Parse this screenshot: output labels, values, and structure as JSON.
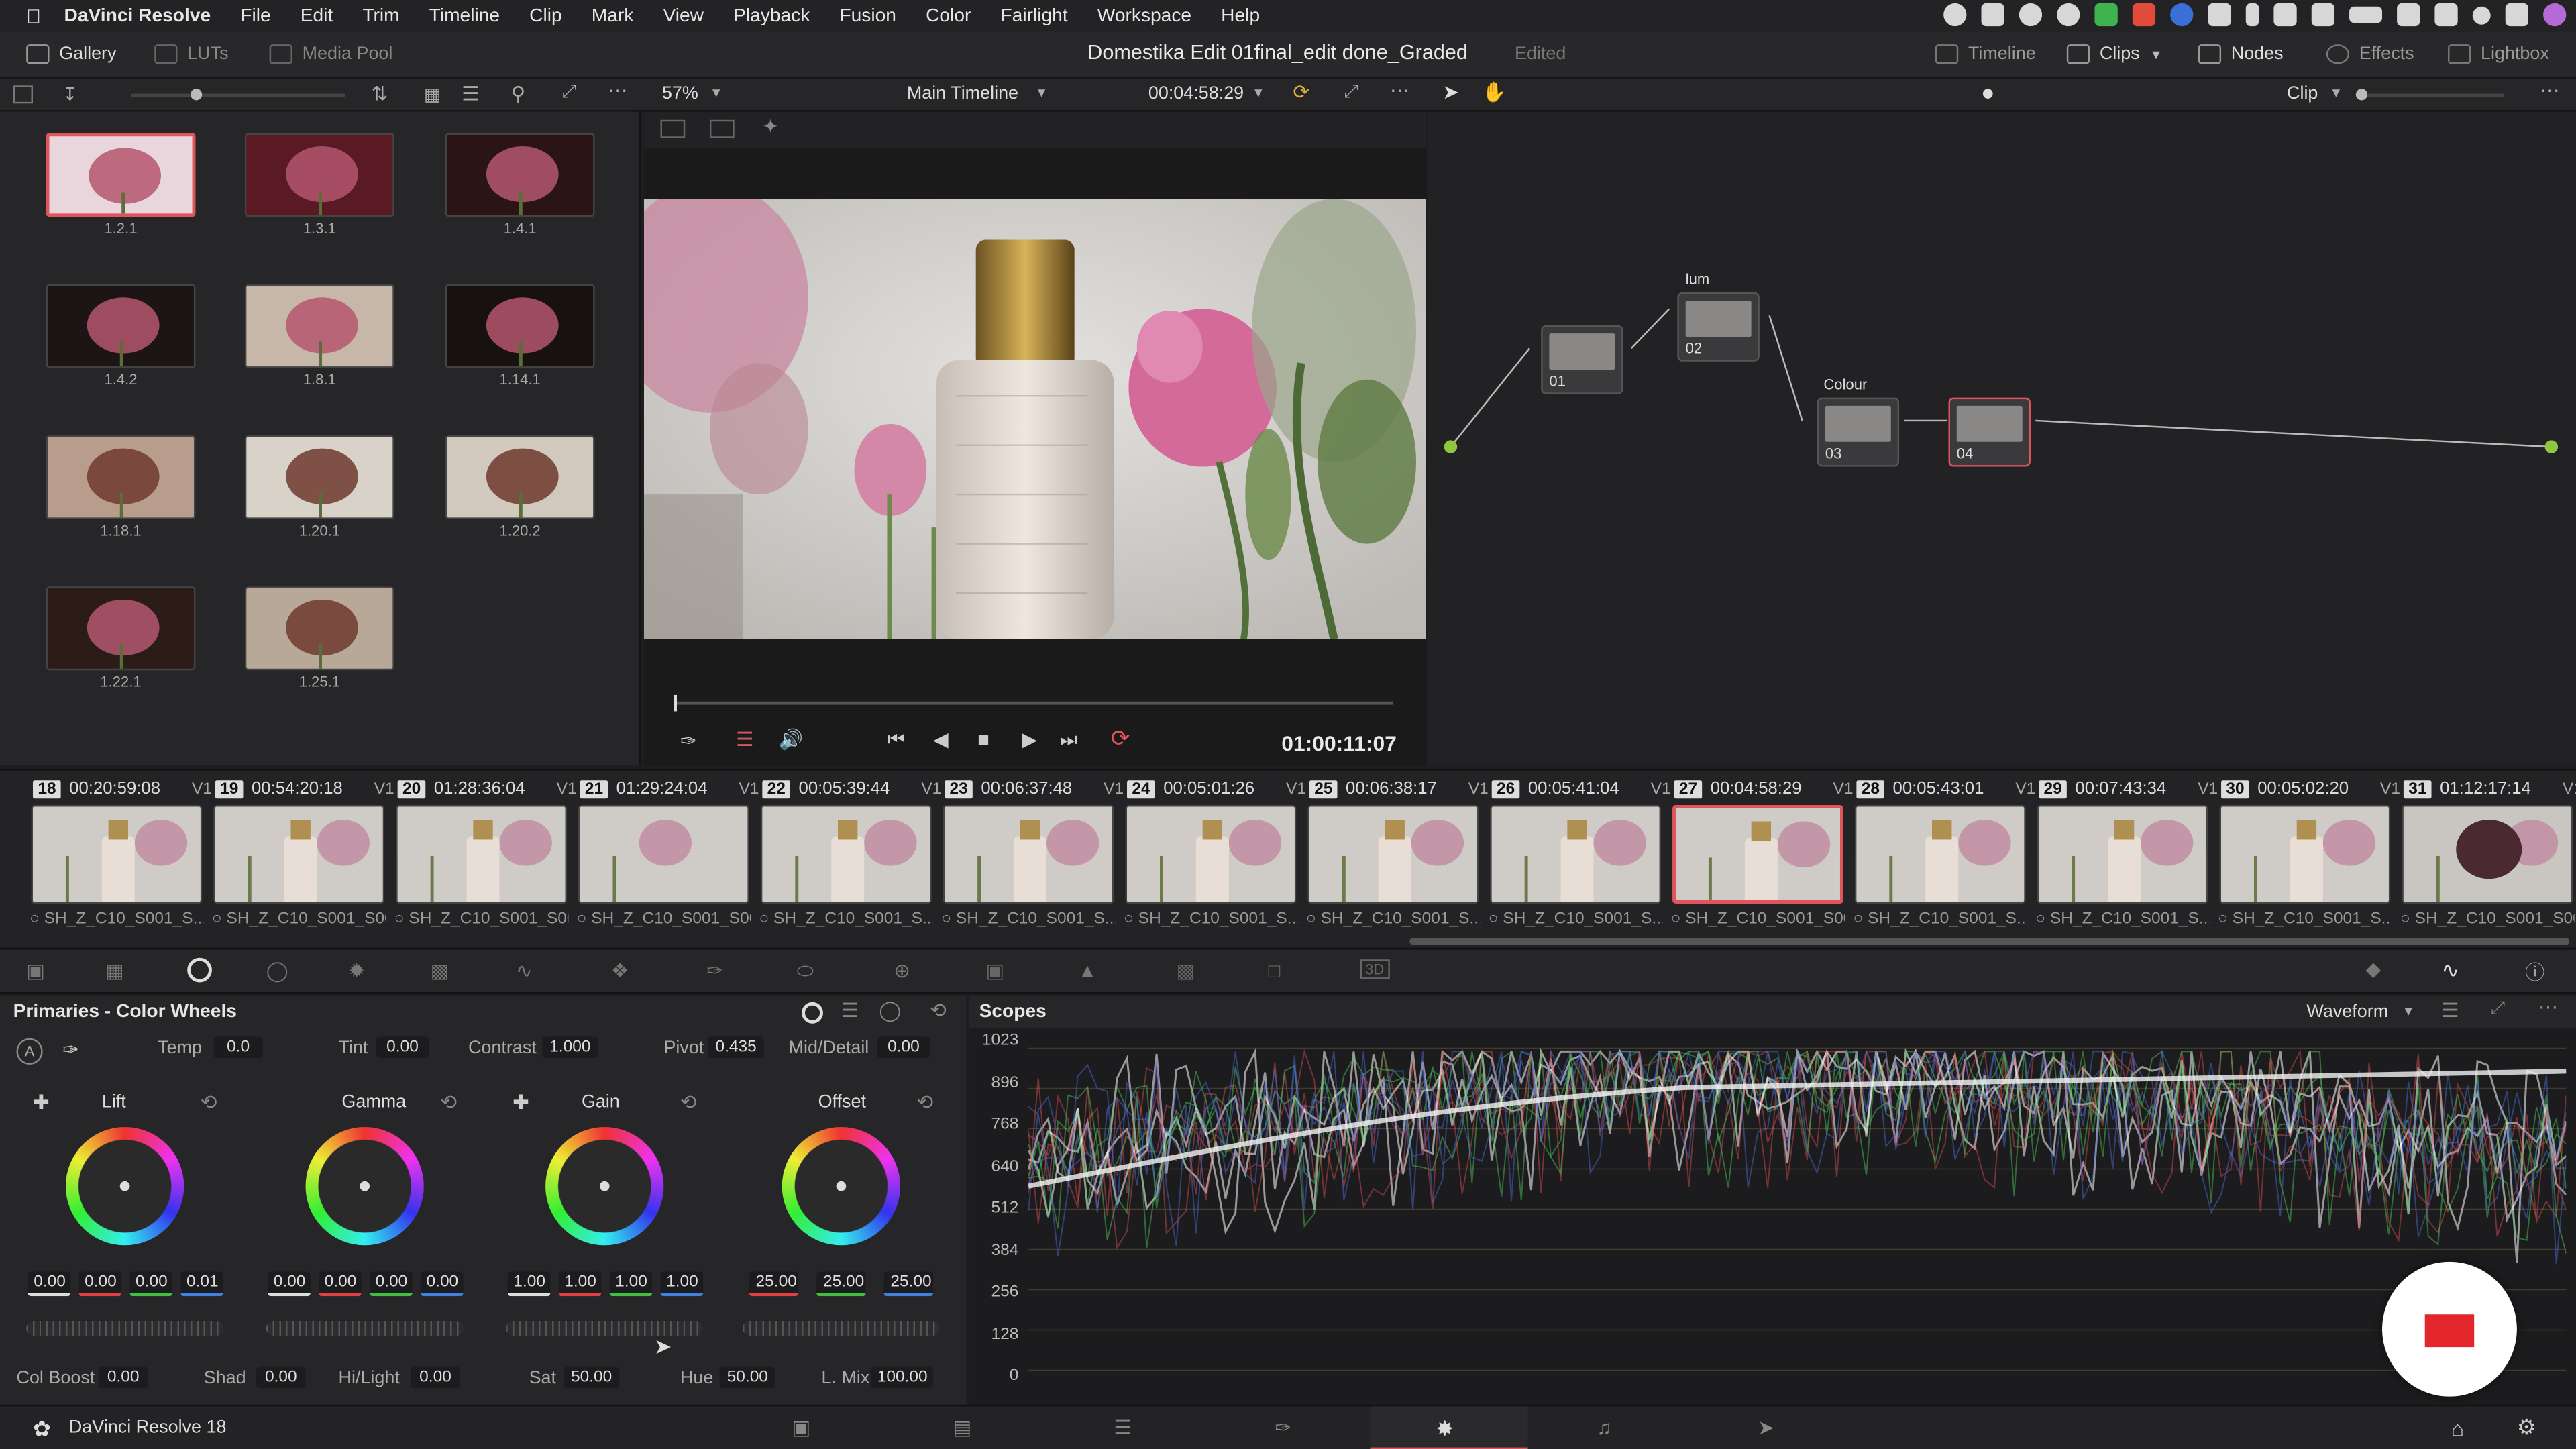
{
  "menubar": {
    "app_name": "DaVinci Resolve",
    "items": [
      "File",
      "Edit",
      "Trim",
      "Timeline",
      "Clip",
      "Mark",
      "View",
      "Playback",
      "Fusion",
      "Color",
      "Fairlight",
      "Workspace",
      "Help"
    ]
  },
  "toolbar": {
    "gallery": "Gallery",
    "luts": "LUTs",
    "media_pool": "Media Pool",
    "project_title": "Domestika Edit 01final_edit done_Graded",
    "edited": "Edited",
    "timeline": "Timeline",
    "clips": "Clips",
    "nodes": "Nodes",
    "effects": "Effects",
    "lightbox": "Lightbox"
  },
  "viewer": {
    "zoom": "57%",
    "timeline_name": "Main Timeline",
    "timecode_top": "00:04:58:29",
    "timecode_bottom": "01:00:11:07",
    "mode": "Clip"
  },
  "gallery": {
    "stills": [
      "1.2.1",
      "1.3.1",
      "1.4.1",
      "1.4.2",
      "1.8.1",
      "1.14.1",
      "1.18.1",
      "1.20.1",
      "1.20.2",
      "1.22.1",
      "1.25.1"
    ]
  },
  "nodes": {
    "items": [
      {
        "id": "01",
        "label": ""
      },
      {
        "id": "02",
        "label": "lum"
      },
      {
        "id": "03",
        "label": "Colour"
      },
      {
        "id": "04",
        "label": ""
      }
    ]
  },
  "timeline": {
    "clips": [
      {
        "num": "18",
        "tc": "00:20:59:08",
        "track": "V1",
        "name": "SH_Z_C10_S001_S..."
      },
      {
        "num": "19",
        "tc": "00:54:20:18",
        "track": "V1",
        "name": "SH_Z_C10_S001_S00..."
      },
      {
        "num": "20",
        "tc": "01:28:36:04",
        "track": "V1",
        "name": "SH_Z_C10_S001_S00..."
      },
      {
        "num": "21",
        "tc": "01:29:24:04",
        "track": "V1",
        "name": "SH_Z_C10_S001_S00..."
      },
      {
        "num": "22",
        "tc": "00:05:39:44",
        "track": "V1",
        "name": "SH_Z_C10_S001_S..."
      },
      {
        "num": "23",
        "tc": "00:06:37:48",
        "track": "V1",
        "name": "SH_Z_C10_S001_S..."
      },
      {
        "num": "24",
        "tc": "00:05:01:26",
        "track": "V1",
        "name": "SH_Z_C10_S001_S..."
      },
      {
        "num": "25",
        "tc": "00:06:38:17",
        "track": "V1",
        "name": "SH_Z_C10_S001_S..."
      },
      {
        "num": "26",
        "tc": "00:05:41:04",
        "track": "V1",
        "name": "SH_Z_C10_S001_S..."
      },
      {
        "num": "27",
        "tc": "00:04:58:29",
        "track": "V1",
        "name": "SH_Z_C10_S001_S00..."
      },
      {
        "num": "28",
        "tc": "00:05:43:01",
        "track": "V1",
        "name": "SH_Z_C10_S001_S..."
      },
      {
        "num": "29",
        "tc": "00:07:43:34",
        "track": "V1",
        "name": "SH_Z_C10_S001_S..."
      },
      {
        "num": "30",
        "tc": "00:05:02:20",
        "track": "V1",
        "name": "SH_Z_C10_S001_S..."
      },
      {
        "num": "31",
        "tc": "01:12:17:14",
        "track": "V1",
        "name": "SH_Z_C10_S001_S00..."
      }
    ]
  },
  "primaries": {
    "title": "Primaries - Color Wheels",
    "temp_label": "Temp",
    "temp": "0.0",
    "tint_label": "Tint",
    "tint": "0.00",
    "contrast_label": "Contrast",
    "contrast": "1.000",
    "pivot_label": "Pivot",
    "pivot": "0.435",
    "middetail_label": "Mid/Detail",
    "middetail": "0.00",
    "wheels": [
      {
        "name": "Lift",
        "values": [
          "0.00",
          "0.00",
          "0.00",
          "0.01"
        ]
      },
      {
        "name": "Gamma",
        "values": [
          "0.00",
          "0.00",
          "0.00",
          "0.00"
        ]
      },
      {
        "name": "Gain",
        "values": [
          "1.00",
          "1.00",
          "1.00",
          "1.00"
        ]
      },
      {
        "name": "Offset",
        "values": [
          "25.00",
          "25.00",
          "25.00"
        ]
      }
    ],
    "colboost_label": "Col Boost",
    "colboost": "0.00",
    "shad_label": "Shad",
    "shad": "0.00",
    "hilight_label": "Hi/Light",
    "hilight": "0.00",
    "sat_label": "Sat",
    "sat": "50.00",
    "hue_label": "Hue",
    "hue": "50.00",
    "lmix_label": "L. Mix",
    "lmix": "100.00"
  },
  "scopes": {
    "title": "Scopes",
    "mode": "Waveform",
    "ticks": [
      "1023",
      "896",
      "768",
      "640",
      "512",
      "384",
      "256",
      "128",
      "0"
    ]
  },
  "bottombar": {
    "version": "DaVinci Resolve 18"
  },
  "colors": {
    "accent_red": "#e0545c",
    "node_green": "#8ec63f",
    "node_blue": "#3aa0e0"
  }
}
